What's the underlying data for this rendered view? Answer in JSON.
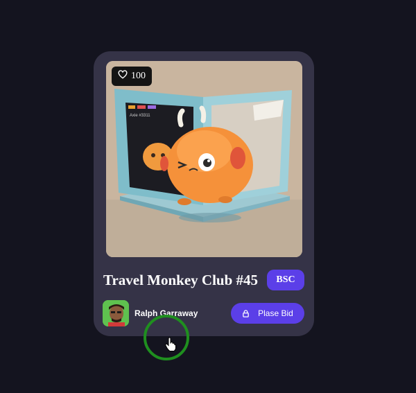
{
  "card": {
    "likes": "100",
    "title": "Travel Monkey Club #45",
    "chain_badge": "BSC",
    "owner_name": "Ralph Garraway",
    "bid_label": "Plase Bid"
  },
  "icons": {
    "likes": "heart-icon",
    "bid": "lock-icon",
    "cursor": "hand-pointer-icon"
  },
  "colors": {
    "page_background": "#14141f",
    "card_background": "#353347",
    "accent": "#5b3fe8",
    "cursor_ring": "#1f8f1f"
  }
}
